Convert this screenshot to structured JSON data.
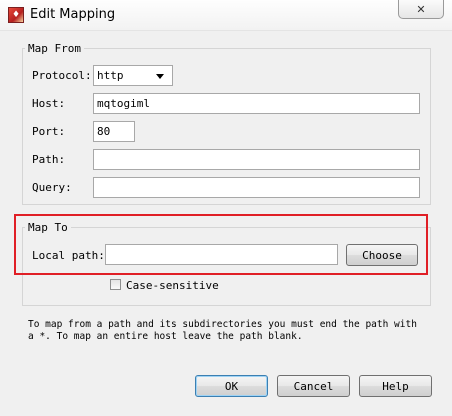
{
  "window": {
    "title": "Edit Mapping",
    "app_icon": "app-icon",
    "close_label": "✕"
  },
  "map_from": {
    "legend": "Map From",
    "protocol_label": "Protocol:",
    "protocol_value": "http",
    "host_label": "Host:",
    "host_value": "mqtogiml",
    "port_label": "Port:",
    "port_value": "80",
    "path_label": "Path:",
    "path_value": "",
    "query_label": "Query:",
    "query_value": ""
  },
  "map_to": {
    "legend": "Map To",
    "local_path_label": "Local path:",
    "local_path_value": "",
    "choose_label": "Choose",
    "highlight_color": "#e01f26"
  },
  "case_sensitive": {
    "label": "Case-sensitive",
    "checked": false
  },
  "note": "To map from a path and its subdirectories you must end the path with a *. To map an entire host leave the path blank.",
  "buttons": {
    "ok": "OK",
    "cancel": "Cancel",
    "help": "Help"
  }
}
